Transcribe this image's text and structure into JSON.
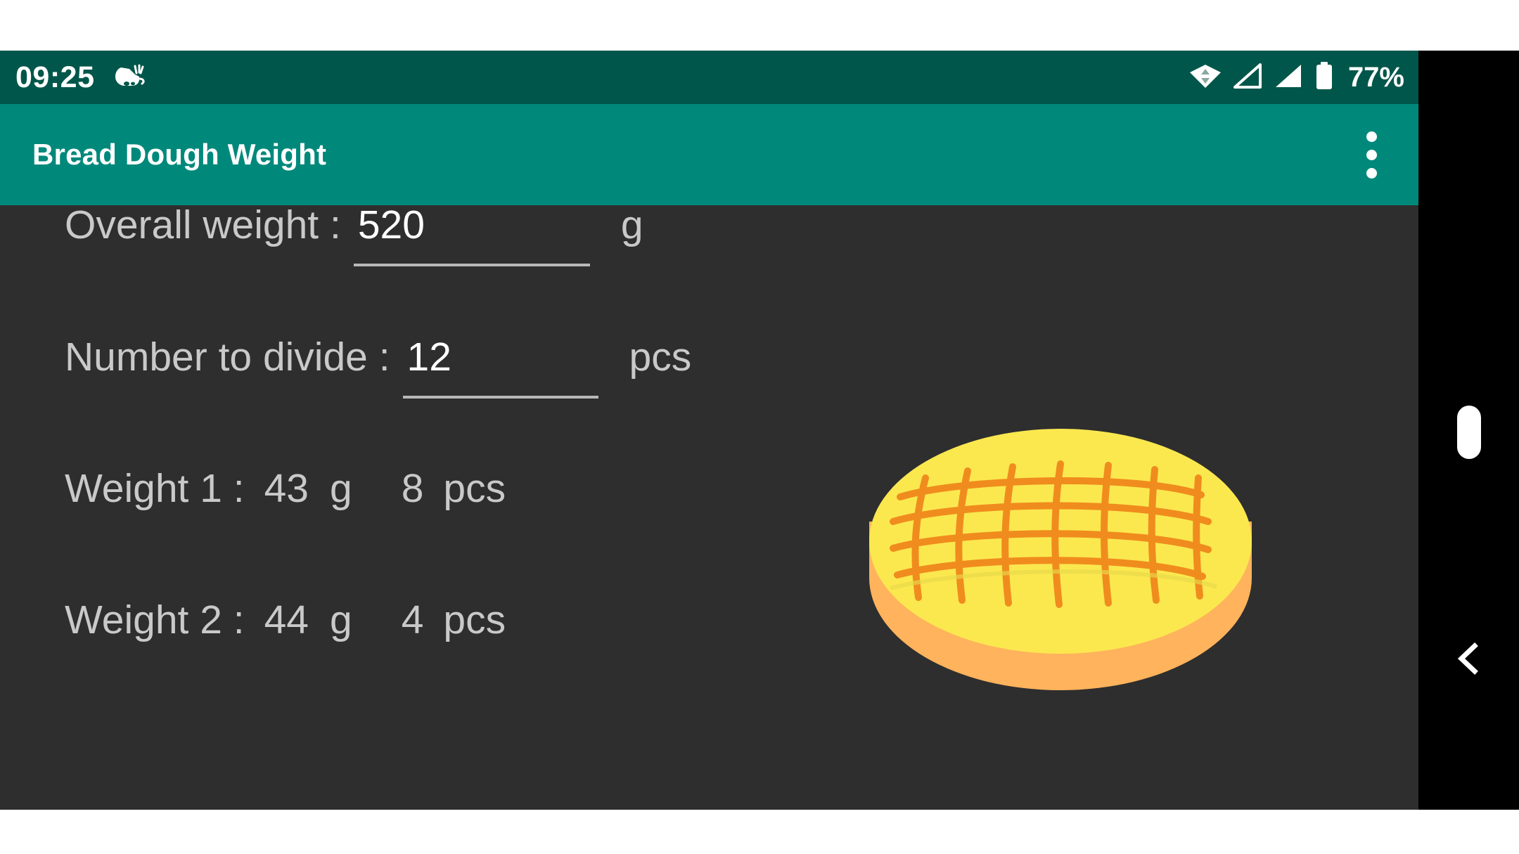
{
  "status_bar": {
    "time": "09:25",
    "notification_icon": "bird-steam-icon",
    "wifi_icon": "wifi-transfer-icon",
    "signal_icon_1": "signal-empty-icon",
    "signal_icon_2": "signal-full-icon",
    "battery_icon": "battery-icon",
    "battery_percent": "77%",
    "bg_color": "#00564a"
  },
  "app_bar": {
    "title": "Bread Dough Weight",
    "overflow_icon": "more-vertical-icon",
    "bg_color": "#00897b"
  },
  "content": {
    "bg_color": "#2e2e2e",
    "rows": {
      "overall": {
        "label": "Overall weight :",
        "value": "520",
        "placeholder": "",
        "unit": "g"
      },
      "divide": {
        "label": "Number to divide :",
        "value": "12",
        "placeholder": "",
        "unit": "pcs"
      },
      "weight1": {
        "label": "Weight 1 :",
        "grams": "43",
        "unit_g": "g",
        "count": "8",
        "unit_pcs": "pcs"
      },
      "weight2": {
        "label": "Weight 2 :",
        "grams": "44",
        "unit_g": "g",
        "count": "4",
        "unit_pcs": "pcs"
      }
    },
    "illustration": {
      "name": "bread-loaf-illustration",
      "top_color": "#FBE84F",
      "crust_color": "#FFB35C",
      "score_color": "#F08C1E"
    }
  },
  "nav_strip": {
    "bg_color": "#000000",
    "home_indicator_icon": "home-pill-icon",
    "back_icon": "chevron-left-icon"
  }
}
